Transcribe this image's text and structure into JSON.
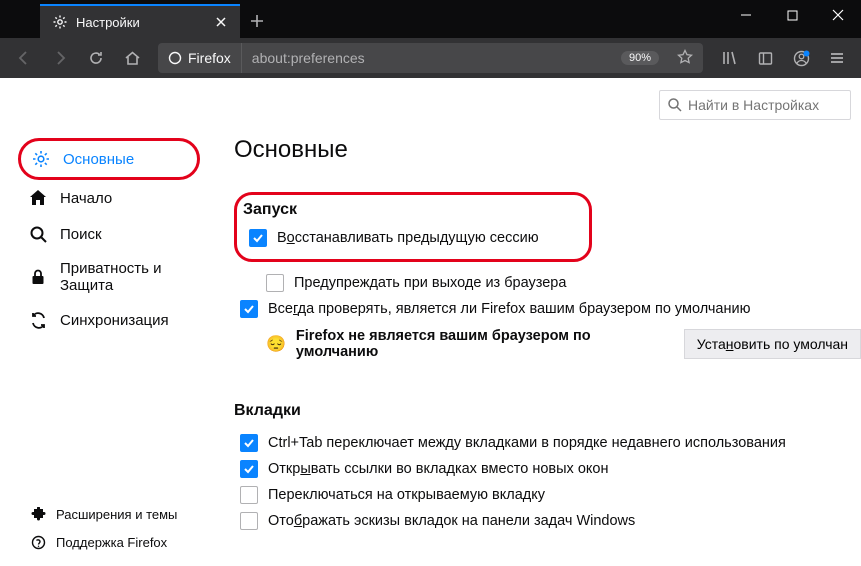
{
  "window": {
    "tab_title": "Настройки"
  },
  "urlbar": {
    "identity": "Firefox",
    "url": "about:preferences",
    "zoom": "90%"
  },
  "search": {
    "placeholder": "Найти в Настройках"
  },
  "sidebar": {
    "items": [
      {
        "label": "Основные"
      },
      {
        "label": "Начало"
      },
      {
        "label": "Поиск"
      },
      {
        "label": "Приватность и Защита"
      },
      {
        "label": "Синхронизация"
      }
    ],
    "footer": [
      {
        "label": "Расширения и темы"
      },
      {
        "label": "Поддержка Firefox"
      }
    ]
  },
  "main": {
    "heading": "Основные",
    "startup": {
      "title": "Запуск",
      "restore_label_pre": "В",
      "restore_label_ak": "о",
      "restore_label_post": "сстанавливать предыдущую сессию",
      "restore_checked": true,
      "warn_label": "Предупреждать при выходе из браузера",
      "warn_checked": false,
      "always_check_pre": "Все",
      "always_check_ak": "г",
      "always_check_post": "да проверять, является ли Firefox вашим браузером по умолчанию",
      "always_check_checked": true,
      "not_default_text": "Firefox не является вашим браузером по умолчанию",
      "make_default_pre": "Уста",
      "make_default_ak": "н",
      "make_default_post": "овить по умолчан"
    },
    "tabs": {
      "title": "Вкладки",
      "ctrl_tab_label": "Ctrl+Tab переключает между вкладками в порядке недавнего использования",
      "ctrl_tab_checked": true,
      "open_links_pre": "Откр",
      "open_links_ak": "ы",
      "open_links_post": "вать ссылки во вкладках вместо новых окон",
      "open_links_checked": true,
      "switch_label": "Переключаться на открываемую вкладку",
      "switch_checked": false,
      "taskbar_pre": "Ото",
      "taskbar_ak": "б",
      "taskbar_post": "ражать эскизы вкладок на панели задач Windows",
      "taskbar_checked": false
    }
  }
}
